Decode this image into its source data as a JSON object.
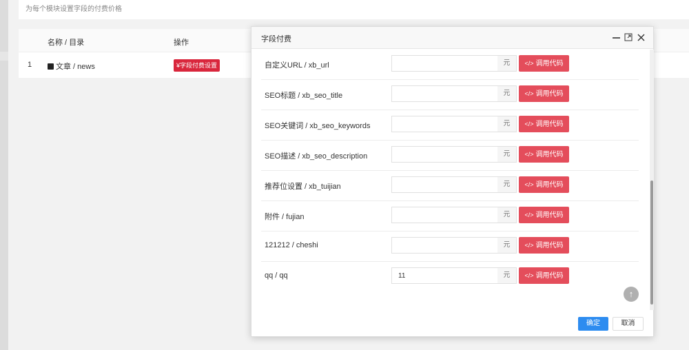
{
  "page": {
    "description": "为每个模块设置字段的付费价格"
  },
  "table": {
    "headers": [
      "名称 / 目录",
      "操作"
    ],
    "rows": [
      {
        "index": "1",
        "name": "文章 / news",
        "action": "¥字段付费设置"
      }
    ]
  },
  "modal": {
    "title": "字段付费",
    "fields": [
      {
        "label": "自定义URL / xb_url",
        "value": "",
        "unit": "元",
        "button": "调用代码"
      },
      {
        "label": "SEO标题 / xb_seo_title",
        "value": "",
        "unit": "元",
        "button": "调用代码"
      },
      {
        "label": "SEO关键词 / xb_seo_keywords",
        "value": "",
        "unit": "元",
        "button": "调用代码"
      },
      {
        "label": "SEO描述 / xb_seo_description",
        "value": "",
        "unit": "元",
        "button": "调用代码"
      },
      {
        "label": "推荐位设置 / xb_tuijian",
        "value": "",
        "unit": "元",
        "button": "调用代码"
      },
      {
        "label": "附件 / fujian",
        "value": "",
        "unit": "元",
        "button": "调用代码"
      },
      {
        "label": "121212 / cheshi",
        "value": "",
        "unit": "元",
        "button": "调用代码"
      },
      {
        "label": "qq / qq",
        "value": "11",
        "unit": "元",
        "button": "调用代码"
      }
    ],
    "ok_label": "确定",
    "cancel_label": "取消"
  },
  "icons": {
    "minimize": "minimize-icon",
    "maximize": "maximize-icon",
    "close": "close-icon",
    "code": "code-icon",
    "scroll_top": "arrow-up-icon",
    "document": "document-icon"
  },
  "colors": {
    "primary_button": "#2d8cf0",
    "code_button": "#e44d5b",
    "action_badge": "#d9263c"
  }
}
